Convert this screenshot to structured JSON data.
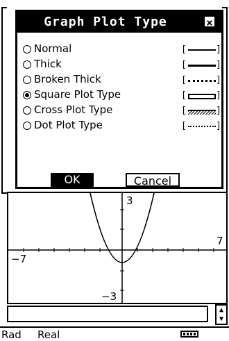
{
  "dialog": {
    "title": "Graph Plot Type",
    "close_icon": "close-icon",
    "options": [
      {
        "label": "Normal",
        "style": "normal",
        "selected": false
      },
      {
        "label": "Thick",
        "style": "thick",
        "selected": false
      },
      {
        "label": "Broken Thick",
        "style": "broken",
        "selected": false
      },
      {
        "label": "Square Plot Type",
        "style": "square",
        "selected": true
      },
      {
        "label": "Cross Plot Type",
        "style": "cross",
        "selected": false
      },
      {
        "label": "Dot Plot Type",
        "style": "dot",
        "selected": false
      }
    ],
    "ok_label": "OK",
    "cancel_label": "Cancel"
  },
  "graph": {
    "xmin_label": "−7",
    "xmax_label": "7",
    "ymax_label": "3",
    "ymin_label": "−3"
  },
  "status": {
    "angle": "Rad",
    "mode": "Real"
  }
}
